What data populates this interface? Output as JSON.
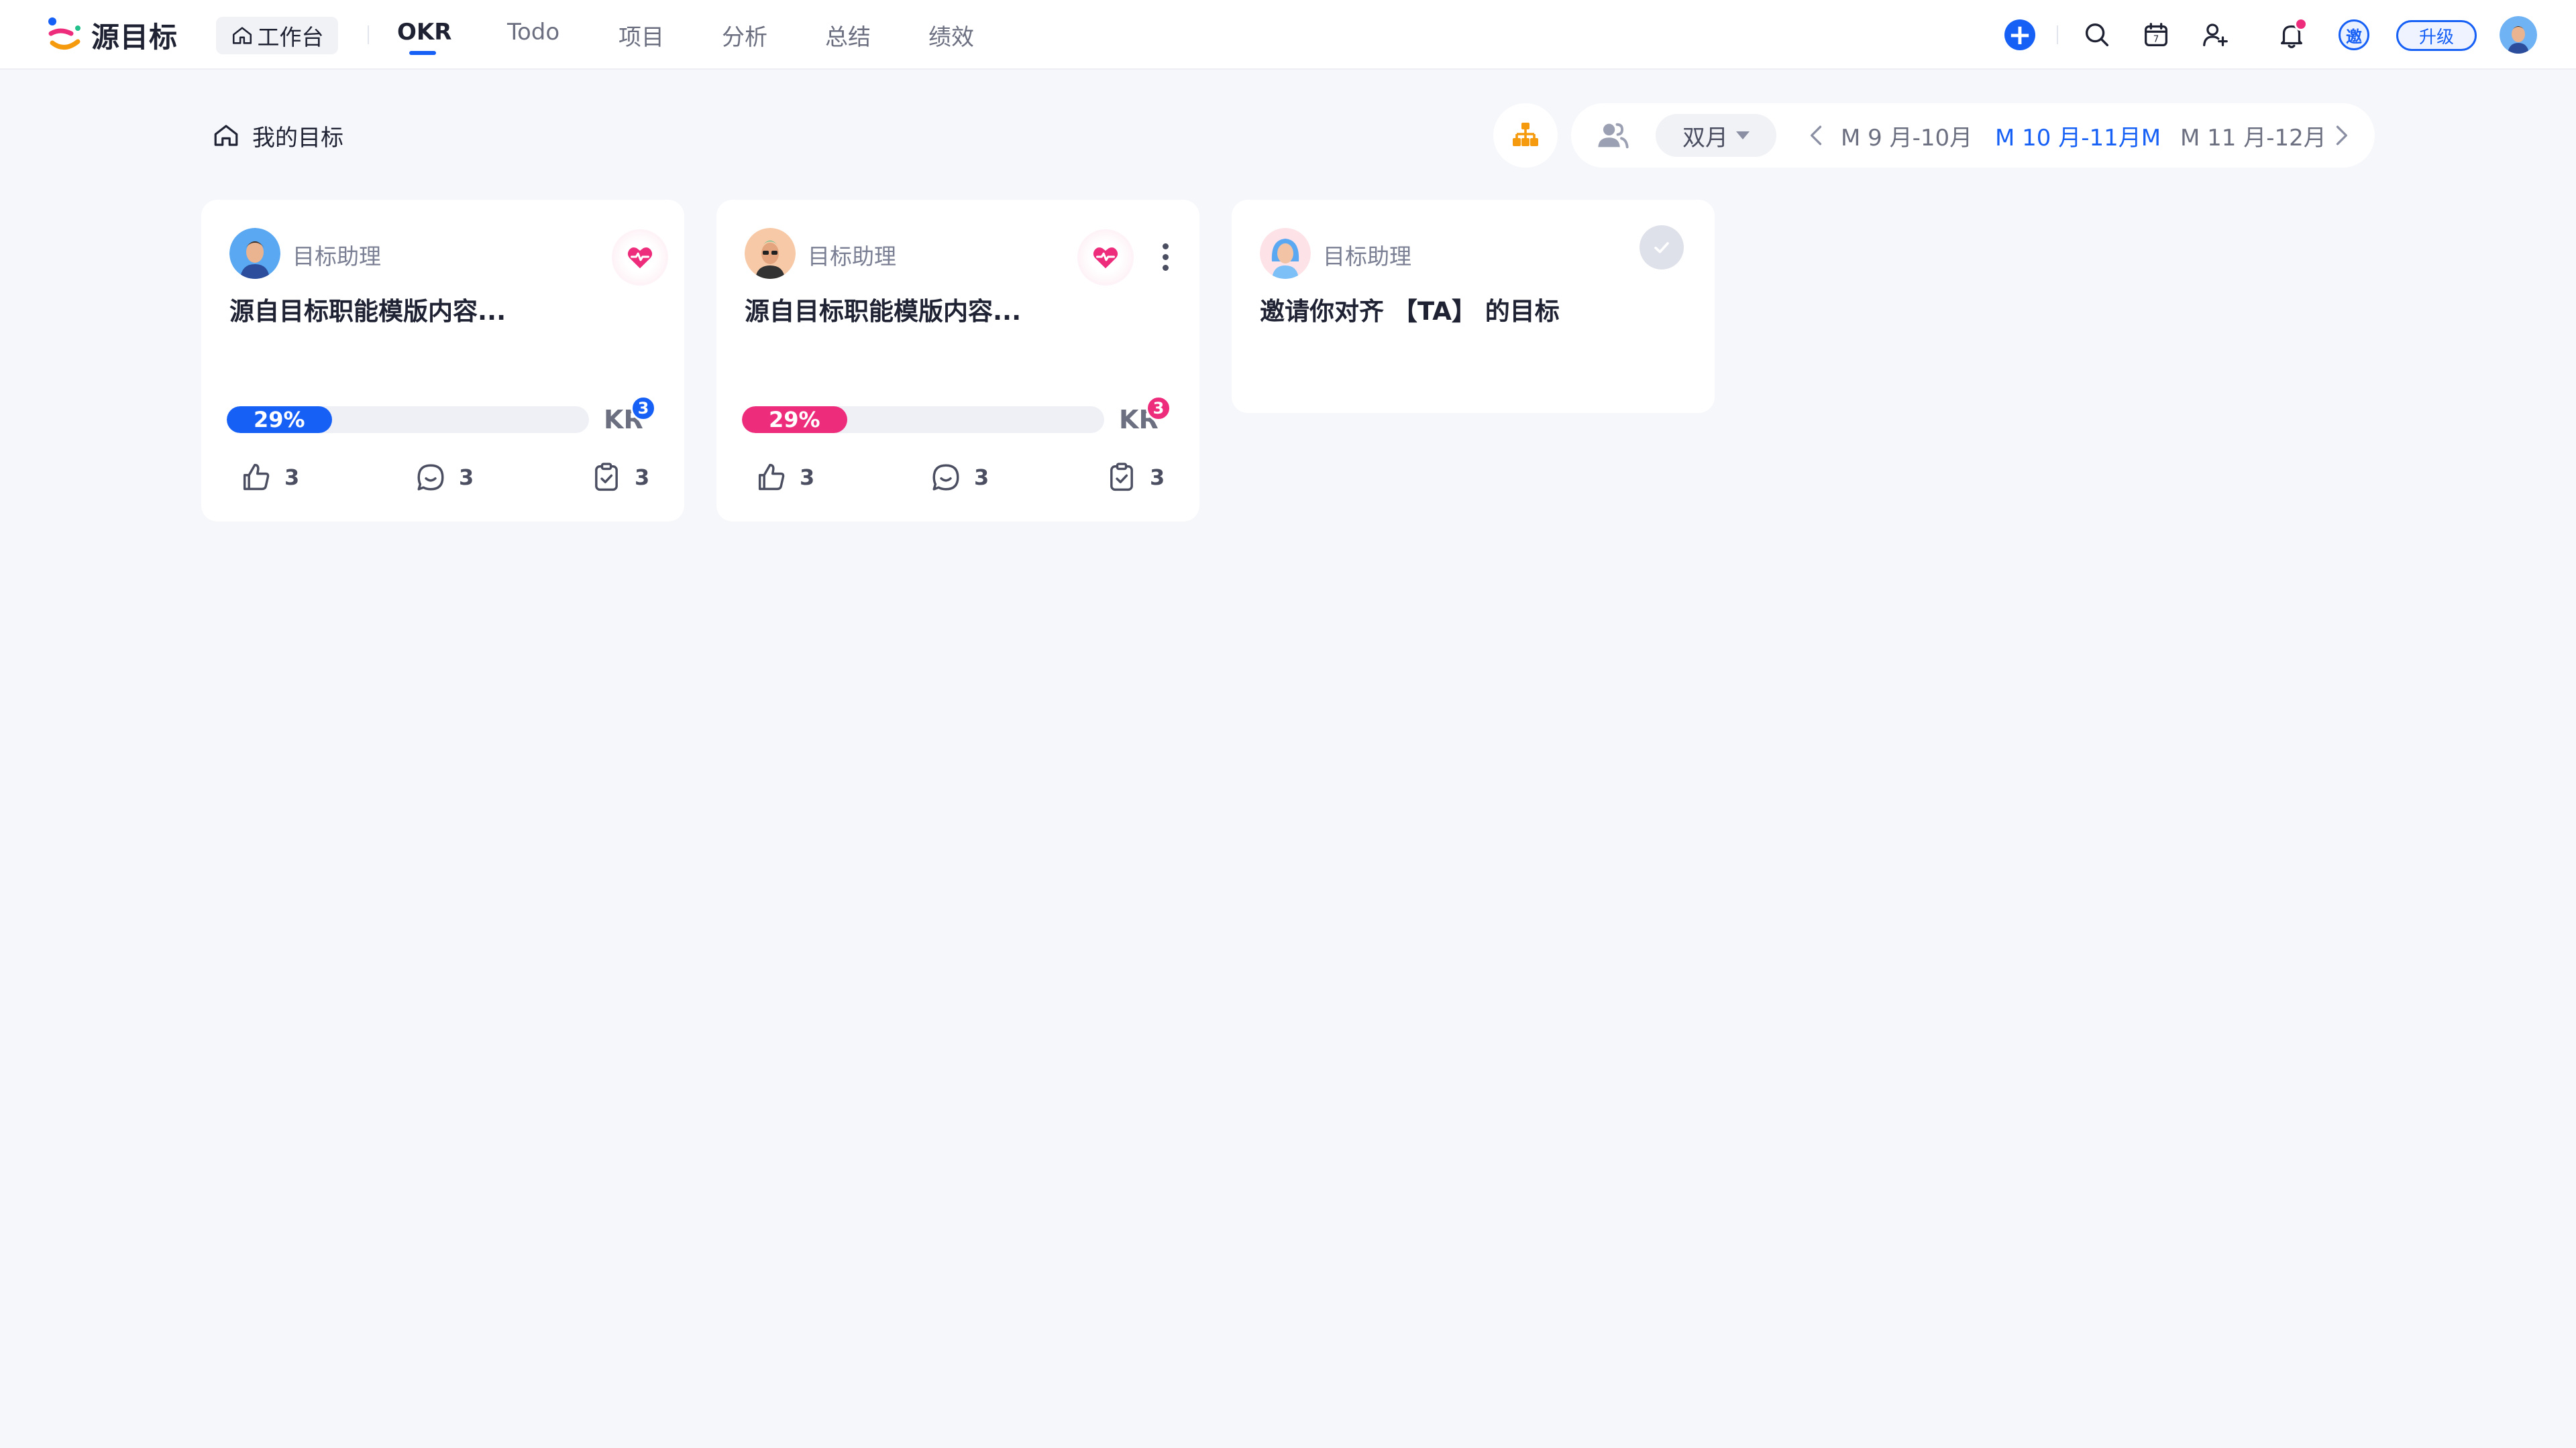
{
  "app": {
    "brand": "源目标",
    "workbench_label": "工作台",
    "nav": [
      {
        "label": "OKR",
        "active": true
      },
      {
        "label": "Todo"
      },
      {
        "label": "项目"
      },
      {
        "label": "分析"
      },
      {
        "label": "总结"
      },
      {
        "label": "绩效"
      }
    ],
    "toolbar": {
      "icons": [
        "add-icon",
        "search-icon",
        "calendar-icon",
        "add-user-icon",
        "bell-icon"
      ],
      "calendar_day": "7",
      "invite_label": "邀",
      "upgrade_label": "升级"
    }
  },
  "header": {
    "breadcrumb": "我的目标",
    "period_select": "双月",
    "periods": [
      {
        "label": "M 9 月-10月"
      },
      {
        "label": "M 10 月-11月M",
        "active": true
      },
      {
        "label": "M 11 月-12月"
      }
    ]
  },
  "cards": [
    {
      "owner": "目标助理",
      "title": "源自目标职能模版内容...",
      "progress_label": "29%",
      "progress_value": 0.29,
      "progress_color": "#1660f5",
      "kr_label": "KR",
      "kr_count": "3",
      "likes": "3",
      "comments": "3",
      "tasks": "3"
    },
    {
      "owner": "目标助理",
      "title": "源自目标职能模版内容...",
      "progress_label": "29%",
      "progress_value": 0.29,
      "progress_color": "#ee2c7c",
      "kr_label": "KR",
      "kr_count": "3",
      "likes": "3",
      "comments": "3",
      "tasks": "3"
    },
    {
      "owner": "目标助理",
      "title": "邀请你对齐 【TA】 的目标"
    }
  ],
  "colors": {
    "accent": "#1660f5",
    "pink": "#ee2c7c",
    "org_icon": "#f59a0c",
    "background": "#f6f7fb"
  }
}
